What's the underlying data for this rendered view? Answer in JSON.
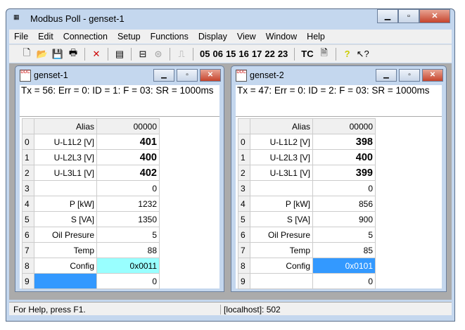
{
  "app": {
    "title": "Modbus Poll - genset-1"
  },
  "menu": [
    "File",
    "Edit",
    "Connection",
    "Setup",
    "Functions",
    "Display",
    "View",
    "Window",
    "Help"
  ],
  "toolbar": {
    "codes": [
      "05",
      "06",
      "15",
      "16",
      "17",
      "22",
      "23"
    ],
    "tc": "TC"
  },
  "windows": [
    {
      "title": "genset-1",
      "status": "Tx = 56: Err = 0: ID = 1: F = 03: SR = 1000ms",
      "header": {
        "alias": "Alias",
        "addr": "00000"
      },
      "rows": [
        {
          "i": "0",
          "a": "U-L1L2 [V]",
          "v": "401",
          "big": true
        },
        {
          "i": "1",
          "a": "U-L2L3 [V]",
          "v": "400",
          "big": true
        },
        {
          "i": "2",
          "a": "U-L3L1 [V]",
          "v": "402",
          "big": true
        },
        {
          "i": "3",
          "a": "",
          "v": "0"
        },
        {
          "i": "4",
          "a": "P [kW]",
          "v": "1232"
        },
        {
          "i": "5",
          "a": "S [VA]",
          "v": "1350"
        },
        {
          "i": "6",
          "a": "Oil Presure",
          "v": "5"
        },
        {
          "i": "7",
          "a": "Temp",
          "v": "88"
        },
        {
          "i": "8",
          "a": "Config",
          "v": "0x0011",
          "hl": "#99ffff"
        },
        {
          "i": "9",
          "a": "",
          "v": "0",
          "ahl": "#3399ff"
        }
      ]
    },
    {
      "title": "genset-2",
      "status": "Tx = 47: Err = 0: ID = 2: F = 03: SR = 1000ms",
      "header": {
        "alias": "Alias",
        "addr": "00000"
      },
      "rows": [
        {
          "i": "0",
          "a": "U-L1L2 [V]",
          "v": "398",
          "big": true
        },
        {
          "i": "1",
          "a": "U-L2L3 [V]",
          "v": "400",
          "big": true
        },
        {
          "i": "2",
          "a": "U-L3L1 [V]",
          "v": "399",
          "big": true
        },
        {
          "i": "3",
          "a": "",
          "v": "0"
        },
        {
          "i": "4",
          "a": "P [kW]",
          "v": "856"
        },
        {
          "i": "5",
          "a": "S [VA]",
          "v": "900"
        },
        {
          "i": "6",
          "a": "Oil Presure",
          "v": "5"
        },
        {
          "i": "7",
          "a": "Temp",
          "v": "85"
        },
        {
          "i": "8",
          "a": "Config",
          "v": "0x0101",
          "hl": "#3399ff",
          "hlc": "#ffffff"
        },
        {
          "i": "9",
          "a": "",
          "v": "0"
        }
      ]
    }
  ],
  "statusbar": {
    "help": "For Help, press F1.",
    "conn": "[localhost]: 502"
  }
}
